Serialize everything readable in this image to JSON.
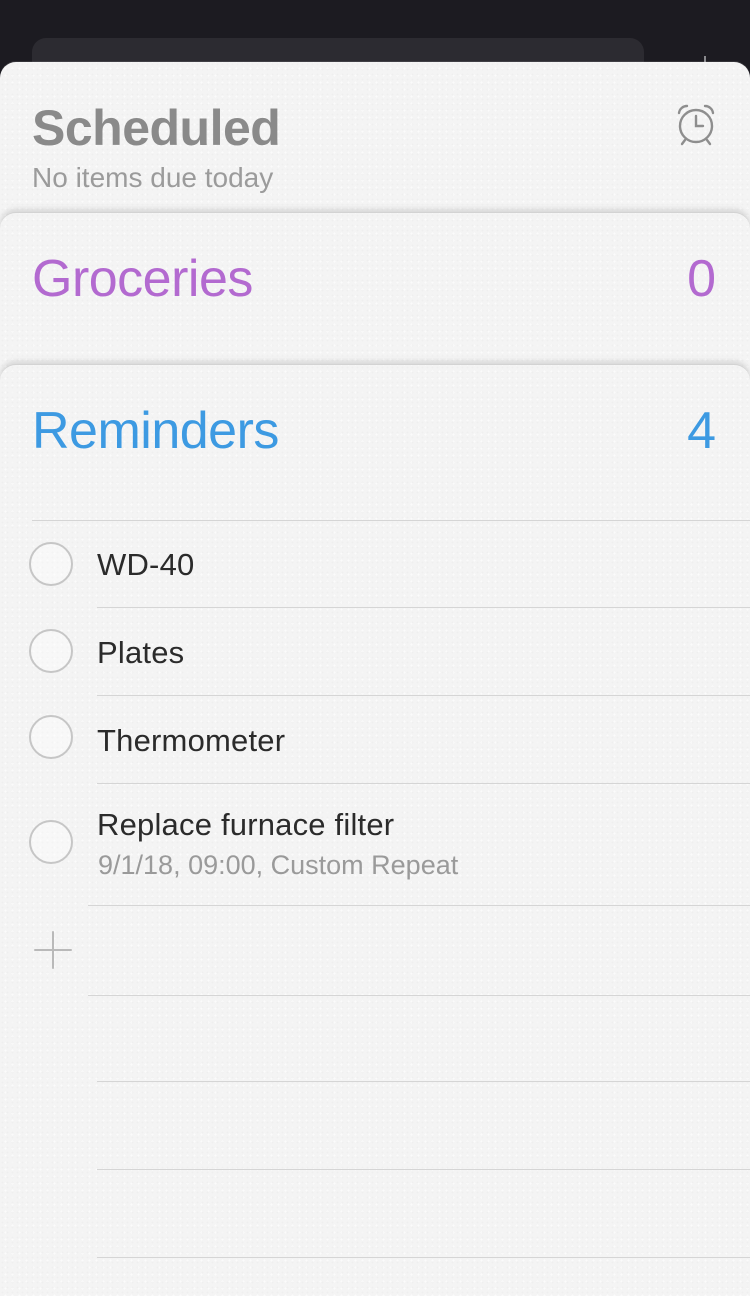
{
  "scheduled": {
    "title": "Scheduled",
    "subtitle": "No items due today",
    "icon": "alarm-clock-icon"
  },
  "lists": [
    {
      "name": "Groceries",
      "count": "0",
      "color": "#b36ad0"
    },
    {
      "name": "Reminders",
      "count": "4",
      "color": "#3d9ae2"
    }
  ],
  "reminders": {
    "items": [
      {
        "title": "WD-40",
        "detail": ""
      },
      {
        "title": "Plates",
        "detail": ""
      },
      {
        "title": "Thermometer",
        "detail": ""
      },
      {
        "title": "Replace furnace filter",
        "detail": "9/1/18, 09:00, Custom Repeat"
      }
    ],
    "add_icon": "plus-icon"
  }
}
